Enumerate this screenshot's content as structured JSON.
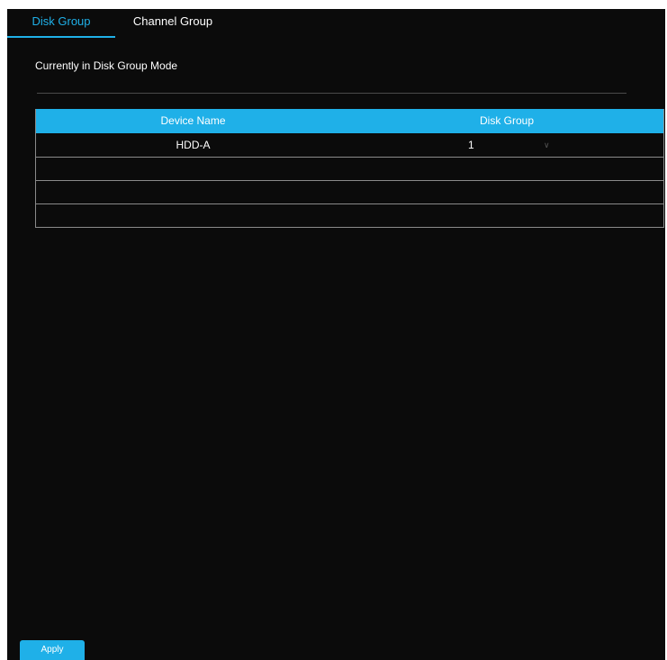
{
  "tabs": [
    {
      "label": "Disk Group",
      "active": true
    },
    {
      "label": "Channel Group",
      "active": false
    }
  ],
  "mode_text": "Currently in Disk Group Mode",
  "table": {
    "columns": [
      "Device Name",
      "Disk Group"
    ],
    "rows": [
      {
        "device_name": "HDD-A",
        "disk_group": "1"
      },
      {
        "device_name": "",
        "disk_group": ""
      },
      {
        "device_name": "",
        "disk_group": ""
      },
      {
        "device_name": "",
        "disk_group": ""
      }
    ]
  },
  "apply_label": "Apply",
  "icons": {
    "dropdown": "chevron-down-icon"
  },
  "colors": {
    "accent": "#1fb0e8",
    "background": "#0b0b0b",
    "border": "#8a8a8a"
  }
}
